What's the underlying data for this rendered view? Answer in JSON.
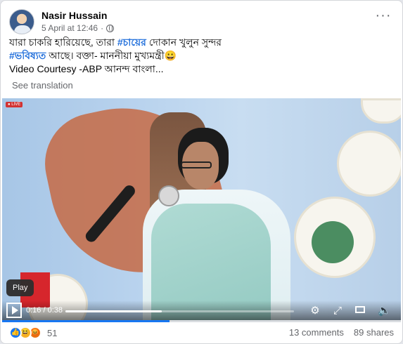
{
  "post": {
    "author": "Nasir Hussain",
    "timestamp": "5 April at 12:46",
    "dot": "·",
    "privacy_icon": "globe-icon",
    "more_icon": "ellipsis-icon",
    "more_label": "···",
    "text_line1_pre": "যারা চাকরি হারিয়েছে, তারা ",
    "text_tag1": "#চায়ের",
    "text_line1_post": " দোকান খুলুন সুন্দর",
    "text_tag2": "#ভবিষ্যত",
    "text_line2_post": " আছে। বক্তা- মাননীয়া মুখ্যমন্ত্রী",
    "text_emoji": "😀",
    "text_line3": "Video Courtesy -ABP আনন্দ বাংলা...",
    "see_translation": "See translation"
  },
  "video": {
    "live_badge": "● LIVE",
    "tooltip": "Play",
    "time": "0:16 / 0:38",
    "progress_fraction": 0.42,
    "icons": [
      "play-icon",
      "settings-icon",
      "expand-icon",
      "pip-icon",
      "volume-icon"
    ]
  },
  "footer": {
    "reaction_icons": [
      "like-icon",
      "haha-icon",
      "angry-icon"
    ],
    "reaction_like_glyph": "👍",
    "reaction_haha_glyph": "😆",
    "reaction_angry_glyph": "😡",
    "reaction_count": "51",
    "comments": "13 comments",
    "shares": "89 shares"
  },
  "colors": {
    "accent": "#1877f2",
    "hashtag": "#216fdb",
    "secondary_text": "#65676b"
  }
}
